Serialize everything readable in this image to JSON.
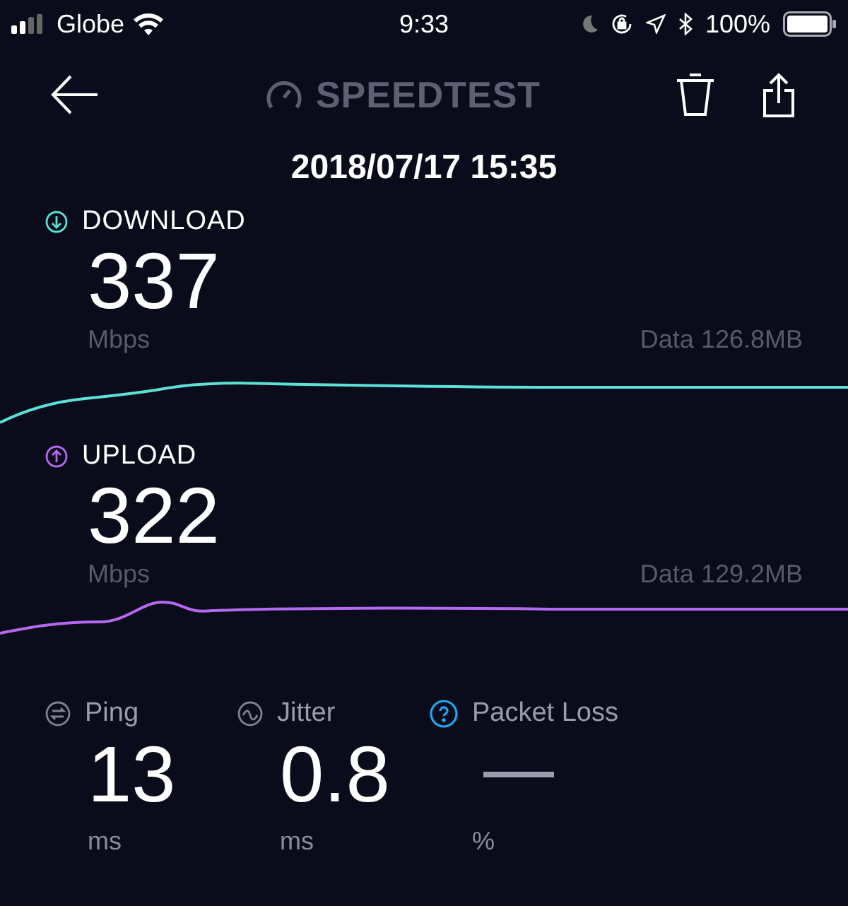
{
  "status_bar": {
    "carrier": "Globe",
    "time": "9:33",
    "battery": "100%"
  },
  "header": {
    "logo_text": "SPEEDTEST"
  },
  "date": "2018/07/17 15:35",
  "results": [
    {
      "kind": "download",
      "label": "DOWNLOAD",
      "value": "337",
      "unit": "Mbps",
      "data": "Data 126.8MB",
      "color": "#5ce1d6"
    },
    {
      "kind": "upload",
      "label": "UPLOAD",
      "value": "322",
      "unit": "Mbps",
      "data": "Data 129.2MB",
      "color": "#b469ef"
    }
  ],
  "stats": [
    {
      "kind": "ping",
      "label": "Ping",
      "value": "13",
      "unit": "ms"
    },
    {
      "kind": "jitter",
      "label": "Jitter",
      "unit": "ms",
      "value": "0.8"
    },
    {
      "kind": "packet_loss",
      "label": "Packet Loss",
      "unit": "%"
    }
  ]
}
